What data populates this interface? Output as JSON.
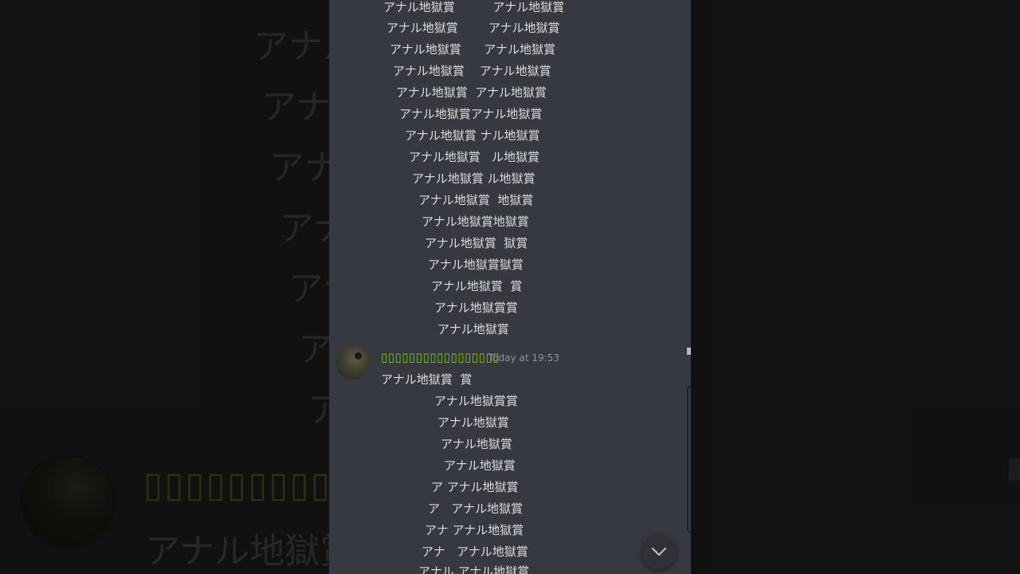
{
  "background": {
    "lines": [
      "アナル",
      "アナル",
      "アナ",
      "アナ",
      "アナ",
      "アナ",
      "アナ"
    ],
    "username": "▯▯▯▯▯▯▯▯▯▯▯▯▯▯▯▯",
    "message": "アナル地獄賞"
  },
  "chat": {
    "previous_message_lines": [
      "アナル地獄賞          アナル地獄賞",
      "アナル地獄賞        アナル地獄賞",
      "アナル地獄賞      アナル地獄賞",
      "アナル地獄賞    アナル地獄賞",
      "アナル地獄賞  アナル地獄賞",
      "アナル地獄賞アナル地獄賞",
      "アナル地獄賞 ナル地獄賞",
      "アナル地獄賞   ル地獄賞",
      "アナル地獄賞 ル地獄賞",
      "アナル地獄賞  地獄賞",
      "アナル地獄賞地獄賞",
      "アナル地獄賞  獄賞",
      "アナル地獄賞獄賞",
      "アナル地獄賞  賞",
      "アナル地獄賞賞",
      "アナル地獄賞"
    ],
    "message": {
      "username": "▯▯▯▯▯▯▯▯▯▯▯▯▯▯▯▯▯",
      "timestamp": "Today at 19:53",
      "lines": [
        "アナル地獄賞  賞",
        "アナル地獄賞賞",
        "アナル地獄賞",
        "アナル地獄賞",
        "アナル地獄賞",
        "ア アナル地獄賞",
        "ア   アナル地獄賞",
        "アナ アナル地獄賞",
        "アナ   アナル地獄賞",
        "アナル アナル地獄賞"
      ]
    },
    "colors": {
      "background": "#36393f",
      "username": "#7ec20f",
      "text": "#dcddde",
      "timestamp": "#8e9297"
    },
    "jump_button_icon": "chevron-down-icon"
  }
}
